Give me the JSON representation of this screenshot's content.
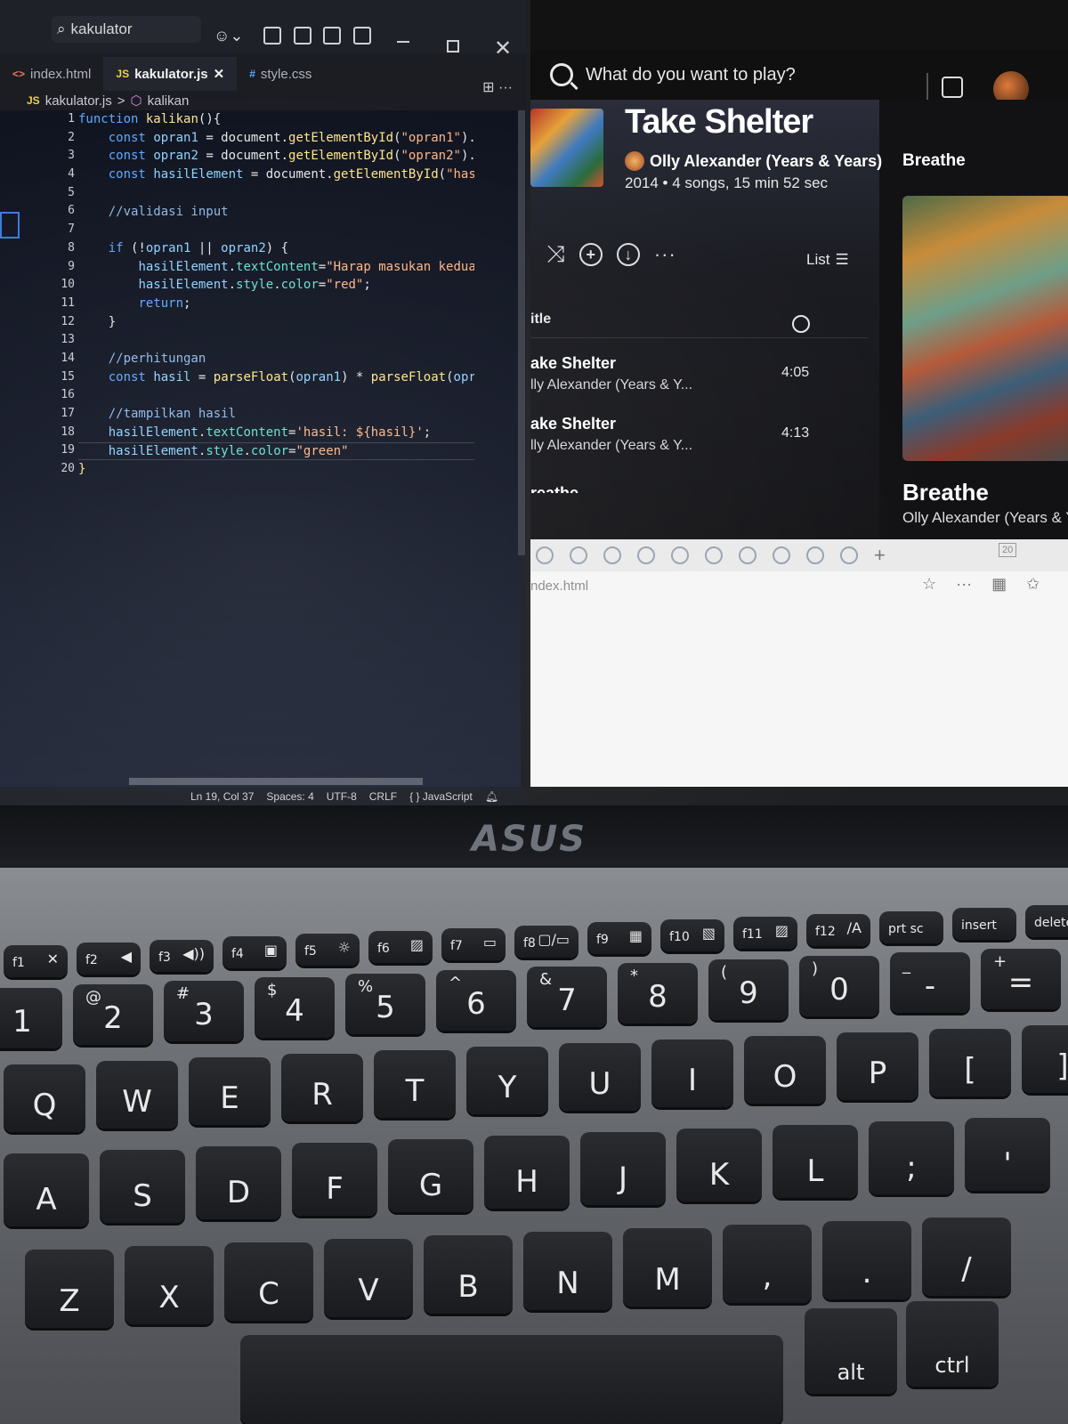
{
  "vscode": {
    "search_text": "kakulator",
    "tabs": [
      {
        "icon": "<>",
        "label": "index.html",
        "active": false
      },
      {
        "icon": "JS",
        "label": "kakulator.js",
        "active": true,
        "close": "✕"
      },
      {
        "icon": "#",
        "label": "style.css",
        "active": false
      }
    ],
    "breadcrumb": {
      "file_icon": "JS",
      "file": "kakulator.js",
      "sep": ">",
      "symbol": "kalikan"
    },
    "line_numbers": [
      "1",
      "2",
      "3",
      "4",
      "5",
      "6",
      "7",
      "8",
      "9",
      "10",
      "11",
      "12",
      "13",
      "14",
      "15",
      "16",
      "17",
      "18",
      "19",
      "20"
    ],
    "status": {
      "position": "Ln 19, Col 37",
      "spaces": "Spaces: 4",
      "encoding": "UTF-8",
      "eol": "CRLF",
      "language": "{ } JavaScript"
    },
    "tab_actions": "⊞ ···"
  },
  "spotify": {
    "search_placeholder": "What do you want to play?",
    "album_title": "Take Shelter",
    "artist": "Olly Alexander (Years & Years)",
    "dot": "•",
    "meta": "2014 • 4 songs, 15 min 52 sec",
    "more": "···",
    "view_mode": "List",
    "col_title": "itle",
    "rows": [
      {
        "title": "ake Shelter",
        "artist": "lly Alexander (Years & Y...",
        "duration": "4:05"
      },
      {
        "title": "ake Shelter",
        "artist": "lly Alexander (Years & Y...",
        "duration": "4:13"
      }
    ],
    "peek_row": "reathe",
    "right_label": "Breathe",
    "now_playing_title": "Breathe",
    "now_playing_artist": "Olly Alexander (Years & Y"
  },
  "browser": {
    "address": "ndex.html",
    "tab_count": "20",
    "plus": "+",
    "actions": [
      "☆",
      "···",
      "▦",
      "✩"
    ]
  },
  "laptop": {
    "brand": "ASUS",
    "fn_keys": [
      {
        "main": "f1",
        "sub": "✕"
      },
      {
        "main": "f2",
        "sub": "◀"
      },
      {
        "main": "f3",
        "sub": "◀))"
      },
      {
        "main": "f4",
        "sub": "▣"
      },
      {
        "main": "f5",
        "sub": "☼"
      },
      {
        "main": "f6",
        "sub": "▨"
      },
      {
        "main": "f7",
        "sub": "▭"
      },
      {
        "main": "f8",
        "sub": "▢/▭"
      },
      {
        "main": "f9",
        "sub": "▦"
      },
      {
        "main": "f10",
        "sub": "▧"
      },
      {
        "main": "f11",
        "sub": "▨"
      },
      {
        "main": "f12",
        "sub": "/A"
      },
      {
        "main": "prt sc",
        "sub": ""
      },
      {
        "main": "insert",
        "sub": ""
      },
      {
        "main": "delete",
        "sub": ""
      }
    ],
    "number_keys": [
      {
        "main": "1",
        "sub": ""
      },
      {
        "main": "2",
        "sub": "@"
      },
      {
        "main": "3",
        "sub": "#"
      },
      {
        "main": "4",
        "sub": "$"
      },
      {
        "main": "5",
        "sub": "%"
      },
      {
        "main": "6",
        "sub": "^"
      },
      {
        "main": "7",
        "sub": "&"
      },
      {
        "main": "8",
        "sub": "*"
      },
      {
        "main": "9",
        "sub": "("
      },
      {
        "main": "0",
        "sub": ")"
      },
      {
        "main": "-",
        "sub": "_"
      },
      {
        "main": "=",
        "sub": "+"
      }
    ],
    "row_q": [
      "Q",
      "W",
      "E",
      "R",
      "T",
      "Y",
      "U",
      "I",
      "O",
      "P",
      "[",
      "]"
    ],
    "row_a": [
      "A",
      "S",
      "D",
      "F",
      "G",
      "H",
      "J",
      "K",
      "L",
      ";",
      "'"
    ],
    "row_z": [
      "Z",
      "X",
      "C",
      "V",
      "B",
      "N",
      "M",
      ",",
      ".",
      "/"
    ],
    "alt_label": "alt",
    "ctrl_label": "ctrl"
  }
}
